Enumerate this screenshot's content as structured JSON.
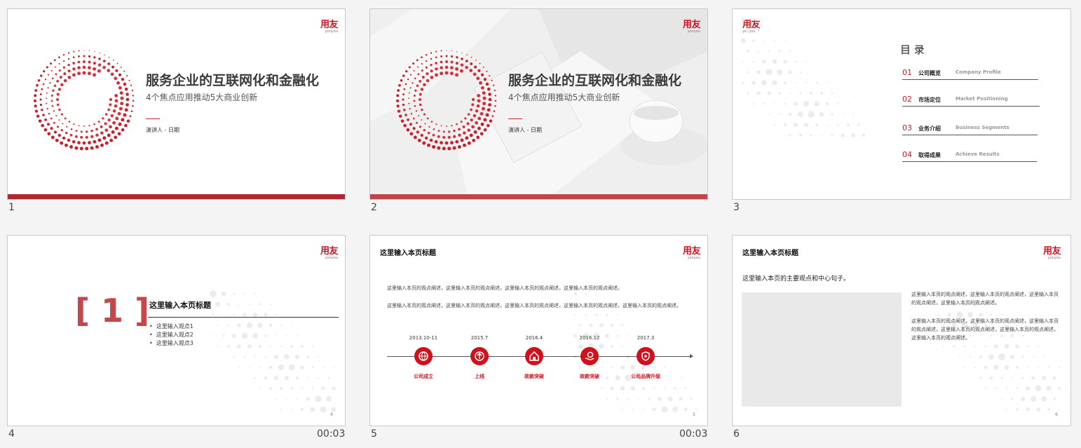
{
  "slides": [
    {
      "number": "1",
      "logo": {
        "brand": "用友",
        "sub": "yonyou"
      },
      "title": "服务企业的互联网化和金融化",
      "subtitle": "4个焦点应用推动5大商业创新",
      "presenter": "演讲人  -  日期"
    },
    {
      "number": "2",
      "logo": {
        "brand": "用友",
        "sub": "yonyou"
      },
      "title": "服务企业的互联网化和金融化",
      "subtitle": "4个焦点应用推动5大商业创新",
      "presenter": "演讲人  -  日期"
    },
    {
      "number": "3",
      "logo": {
        "brand": "用友",
        "sub": "yonyou"
      },
      "toc_title": "目 录",
      "toc": [
        {
          "num": "01",
          "cn": "公司概览",
          "en": "Company Profile"
        },
        {
          "num": "02",
          "cn": "市场定位",
          "en": "Market Positioning"
        },
        {
          "num": "03",
          "cn": "业务介绍",
          "en": "Business Segments"
        },
        {
          "num": "04",
          "cn": "取得成果",
          "en": "Achieve Results"
        }
      ]
    },
    {
      "number": "4",
      "time": "00:03",
      "logo": {
        "brand": "用友",
        "sub": "yonyou"
      },
      "section": "[ 1 ]",
      "title": "这里输入本页标题",
      "bullets": [
        "这里输入观点1",
        "这里输入观点2",
        "这里输入观点3"
      ],
      "page": "4"
    },
    {
      "number": "5",
      "time": "00:03",
      "logo": {
        "brand": "用友",
        "sub": "yonyou"
      },
      "title": "这里输入本页标题",
      "para1": "这里输入本页的观点阐述，这里输入本页的观点阐述，这里输入本页的观点阐述，这里输入本页的观点阐述。",
      "para2": "这里输入本页的观点阐述，这里输入本页的观点阐述，这里输入本页的观点阐述，这里输入本页的观点阐述，这里输入本页的观点阐述。",
      "timeline": [
        {
          "date": "2013.10-11",
          "label": "公司成立",
          "icon": "globe-icon"
        },
        {
          "date": "2015.7",
          "label": "上线",
          "icon": "upload-icon"
        },
        {
          "date": "2016.4",
          "label": "故款突破",
          "icon": "house-icon"
        },
        {
          "date": "2016.12",
          "label": "故款突破",
          "icon": "hand-coin-icon"
        },
        {
          "date": "2017.3",
          "label": "公司品牌升级",
          "icon": "shield-icon"
        }
      ],
      "page": "5"
    },
    {
      "number": "6",
      "logo": {
        "brand": "用友",
        "sub": "yonyou"
      },
      "title": "这里输入本页标题",
      "lead": "这里输入本页的主要观点和中心句子。",
      "para1": "这里输入本页的观点阐述，这里输入本页的观点阐述，这里输入本页的观点阐述，这里输入本页的观点阐述。",
      "para2": "这里输入本页的观点阐述，这里输入本页的观点阐述，这里输入本页的观点阐述，这里输入本页的观点阐述，这里输入本页的观点阐述，这里输入本页的观点阐述。",
      "page": "6"
    }
  ],
  "colors": {
    "brand_red": "#d0111b",
    "bar_red": "#b32830",
    "section_red": "#c6474b"
  }
}
